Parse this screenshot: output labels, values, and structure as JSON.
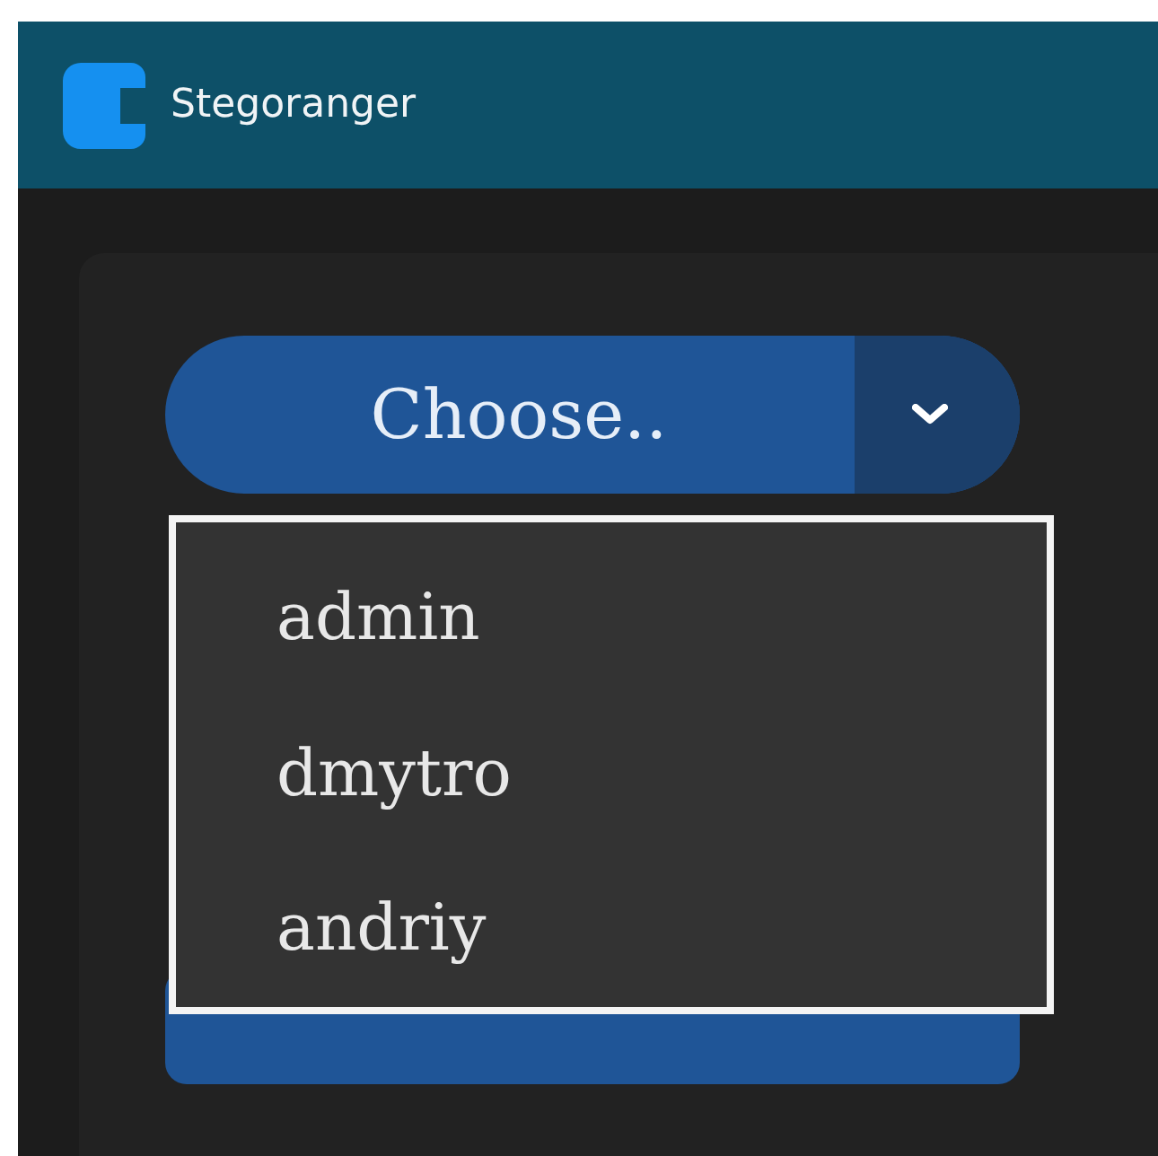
{
  "window": {
    "title": "Stegoranger"
  },
  "user_select": {
    "value": "Choose..",
    "expanded": true,
    "options": [
      {
        "label": "admin",
        "selected": false
      },
      {
        "label": "dmytro",
        "selected": false
      },
      {
        "label": "andriy",
        "selected": false
      }
    ]
  },
  "hidden_button": {
    "kind": "button"
  }
}
